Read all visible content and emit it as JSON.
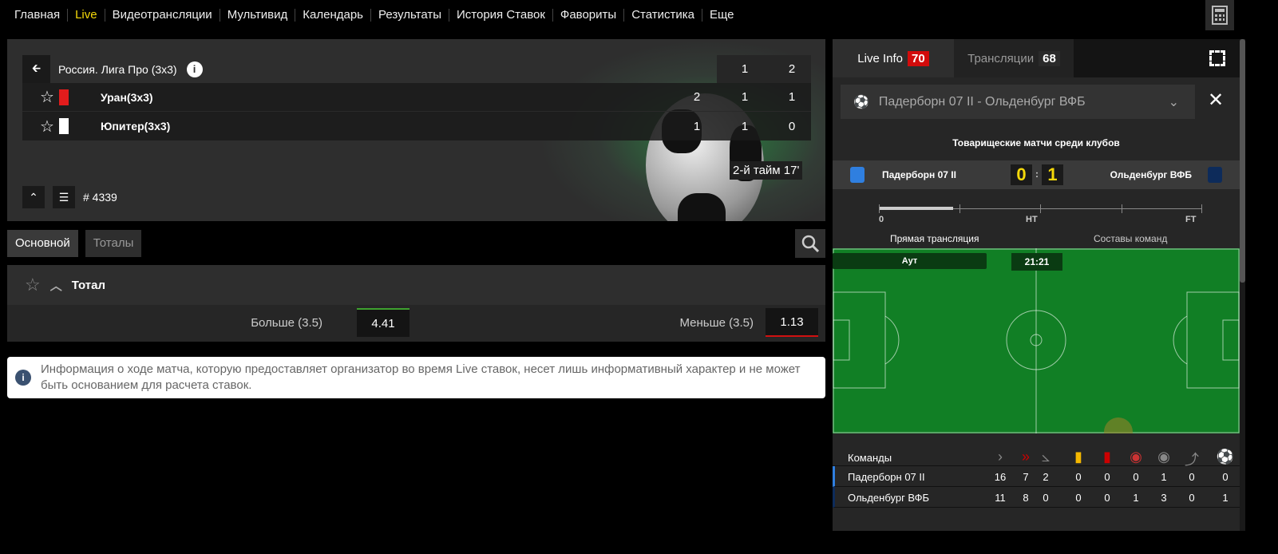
{
  "nav": {
    "items": [
      "Главная",
      "Live",
      "Видеотрансляции",
      "Мультивид",
      "Календарь",
      "Результаты",
      "История Ставок",
      "Фавориты",
      "Статистика",
      "Еще"
    ],
    "active": "Live"
  },
  "event": {
    "league": "Россия. Лига Про (3х3)",
    "period_cols": [
      "1",
      "2"
    ],
    "teams": [
      {
        "name": "Уран(3х3)",
        "kit_color": "#e21c1c",
        "scores": [
          "2",
          "1",
          "1"
        ]
      },
      {
        "name": "Юпитер(3х3)",
        "kit_color": "#ffffff",
        "scores": [
          "1",
          "1",
          "0"
        ]
      }
    ],
    "status": "2-й тайм  17'",
    "id": "# 4339"
  },
  "tabs": [
    "Основной",
    "Тоталы"
  ],
  "market": {
    "title": "Тотал",
    "over_label": "Больше (3.5)",
    "over_odd": "4.41",
    "under_label": "Меньше (3.5)",
    "under_odd": "1.13"
  },
  "notice": "Информация о ходе матча, которую предоставляет организатор во время Live ставок, несет лишь информативный характер и не может быть основанием для расчета ставок.",
  "right": {
    "tab_live": "Live Info",
    "live_count": "70",
    "tab_streams": "Трансляции",
    "streams_count": "68",
    "match_select": "Падерборн 07 II - Ольденбург ВФБ",
    "competition": "Товарищеские матчи среди клубов",
    "home": "Падерборн 07 II",
    "away": "Ольденбург ВФБ",
    "home_score": "0",
    "away_score": "1",
    "home_color": "#2f7fe0",
    "away_color": "#0d2b5a",
    "timeline": {
      "start": "0",
      "ht": "HT",
      "ft": "FT",
      "progress": 0.23
    },
    "sub_live": "Прямая трансляция",
    "sub_lineups": "Составы команд",
    "pitch_event": "Аут",
    "pitch_time": "21:21",
    "stats_header": "Команды",
    "stat_icons": [
      "attacks-icon",
      "dangerous-attacks-icon",
      "corner-icon",
      "yellow-card-icon",
      "red-card-icon",
      "shots-on-target-icon",
      "shots-off-target-icon",
      "substitution-icon",
      "goal-icon"
    ],
    "stats": [
      {
        "team": "Падерборн 07 II",
        "values": [
          "16",
          "7",
          "2",
          "0",
          "0",
          "0",
          "1",
          "0",
          "0"
        ]
      },
      {
        "team": "Ольденбург ВФБ",
        "values": [
          "11",
          "8",
          "0",
          "0",
          "0",
          "1",
          "3",
          "0",
          "1"
        ]
      }
    ]
  }
}
